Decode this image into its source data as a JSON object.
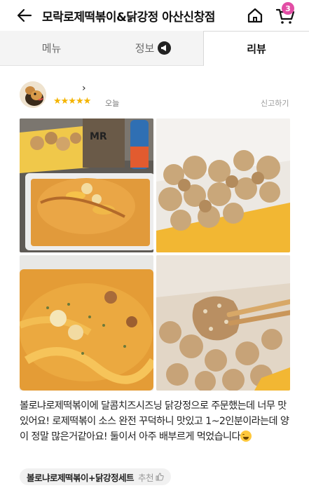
{
  "header": {
    "title": "모락로제떡볶이&닭강정 아산신창점",
    "cart_count": "3",
    "colors": {
      "badge": "#e24ea5"
    }
  },
  "tabs": {
    "menu": "메뉴",
    "info": "정보",
    "review": "리뷰"
  },
  "review": {
    "chevron": "›",
    "stars": "★★★★★",
    "rating": 5,
    "date": "오늘",
    "report": "신고하기",
    "photos": [
      "tteokbokki-and-chicken-box",
      "fried-chicken-box",
      "rose-tteokbokki-closeup",
      "chicken-on-chopsticks"
    ],
    "text": "볼로냐로제떡볶이에 달콤치즈시즈닝 닭강정으로 주문했는데 너무 맛있어요! 로제떡볶이 소스 완전 꾸덕하니 맛있고 1~2인분이라는데 양이 정말 많은거같아요! 둘이서 아주 배부르게 먹었습니다",
    "emoji": "laughing-face-icon",
    "menu_chip": "볼로냐로제떡볶이+닭강정세트",
    "recommend": "추천",
    "colors": {
      "star": "#f4b400"
    }
  }
}
